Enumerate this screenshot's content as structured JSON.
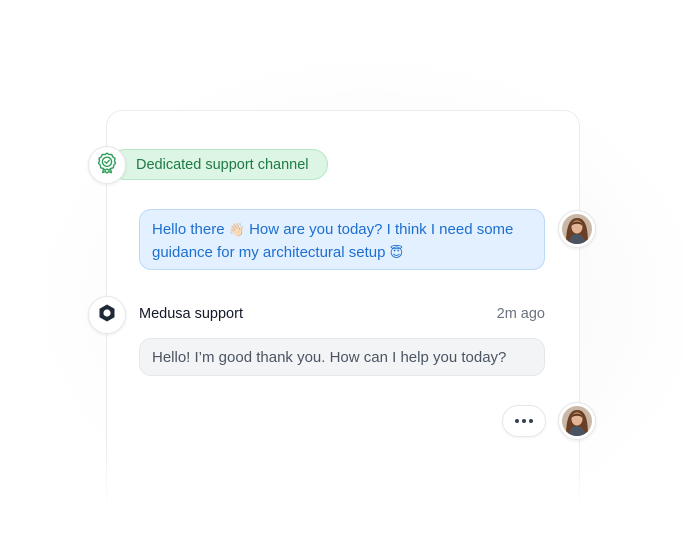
{
  "badge": {
    "label": "Dedicated support channel",
    "icon": "award-check-icon"
  },
  "user_message": {
    "text_part1": "Hello there ",
    "emoji_wave": "👋🏻",
    "text_part2": " How are you today? I think I need some guidance for my architectural setup ",
    "emoji_halo": "😇"
  },
  "support_message": {
    "sender": "Medusa support",
    "time": "2m ago",
    "text": "Hello! I’m good thank you. How can I help you today?"
  },
  "typing_indicator": {
    "icon": "ellipsis-icon"
  },
  "colors": {
    "badge_bg": "#dcf5e4",
    "badge_text": "#1f7a45",
    "user_bubble_bg": "#e3f0ff",
    "user_bubble_text": "#1d6fd0",
    "support_bubble_bg": "#f3f4f6",
    "support_bubble_text": "#4b5563"
  }
}
